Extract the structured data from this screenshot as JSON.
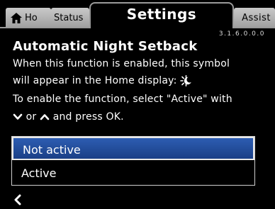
{
  "tabs": {
    "home_label": "Ho",
    "status_label": "Status",
    "settings_label": "Settings",
    "assist_label": "Assist"
  },
  "version": "3.1.6.0.0.0",
  "page": {
    "heading": "Automatic Night Setback",
    "line1": "When this function is enabled, this symbol",
    "line2": "will appear in the Home display:",
    "line3": "To enable the function, select \"Active\" with",
    "line4_or": "or",
    "line4_rest": "and press OK."
  },
  "options": [
    "Not active",
    "Active"
  ],
  "selected_option": "Not active",
  "colors": {
    "selection": "#2351a0",
    "tab_inactive": "#b5b5b5",
    "background": "#000000"
  },
  "icons": [
    "home-icon",
    "night-setback-icon",
    "chevron-down-icon",
    "chevron-up-icon",
    "back-icon"
  ]
}
